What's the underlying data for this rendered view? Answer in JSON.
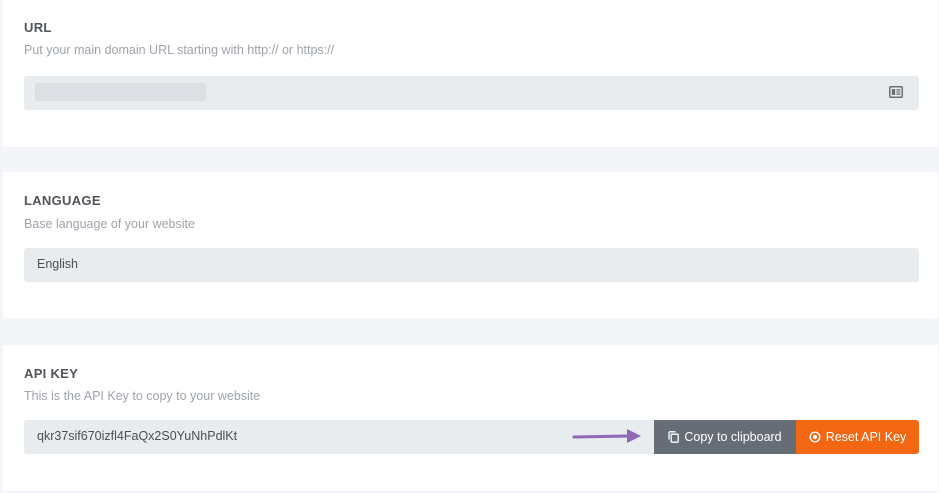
{
  "url_section": {
    "title": "URL",
    "description": "Put your main domain URL starting with http:// or https://",
    "field_icon": "id-card-icon"
  },
  "language_section": {
    "title": "LANGUAGE",
    "description": "Base language of your website",
    "value": "English"
  },
  "api_section": {
    "title": "API KEY",
    "description": "This is the API Key to copy to your website",
    "value": "qkr37sif670izfl4FaQx2S0YuNhPdlKt",
    "copy_label": "Copy to clipboard",
    "copy_icon": "copy-icon",
    "reset_label": "Reset API Key",
    "reset_icon": "reset-icon"
  },
  "colors": {
    "background": "#f4f5f8",
    "field": "#e9ecef",
    "copy_button": "#676d76",
    "reset_button": "#f36713",
    "arrow": "#9168b6"
  }
}
